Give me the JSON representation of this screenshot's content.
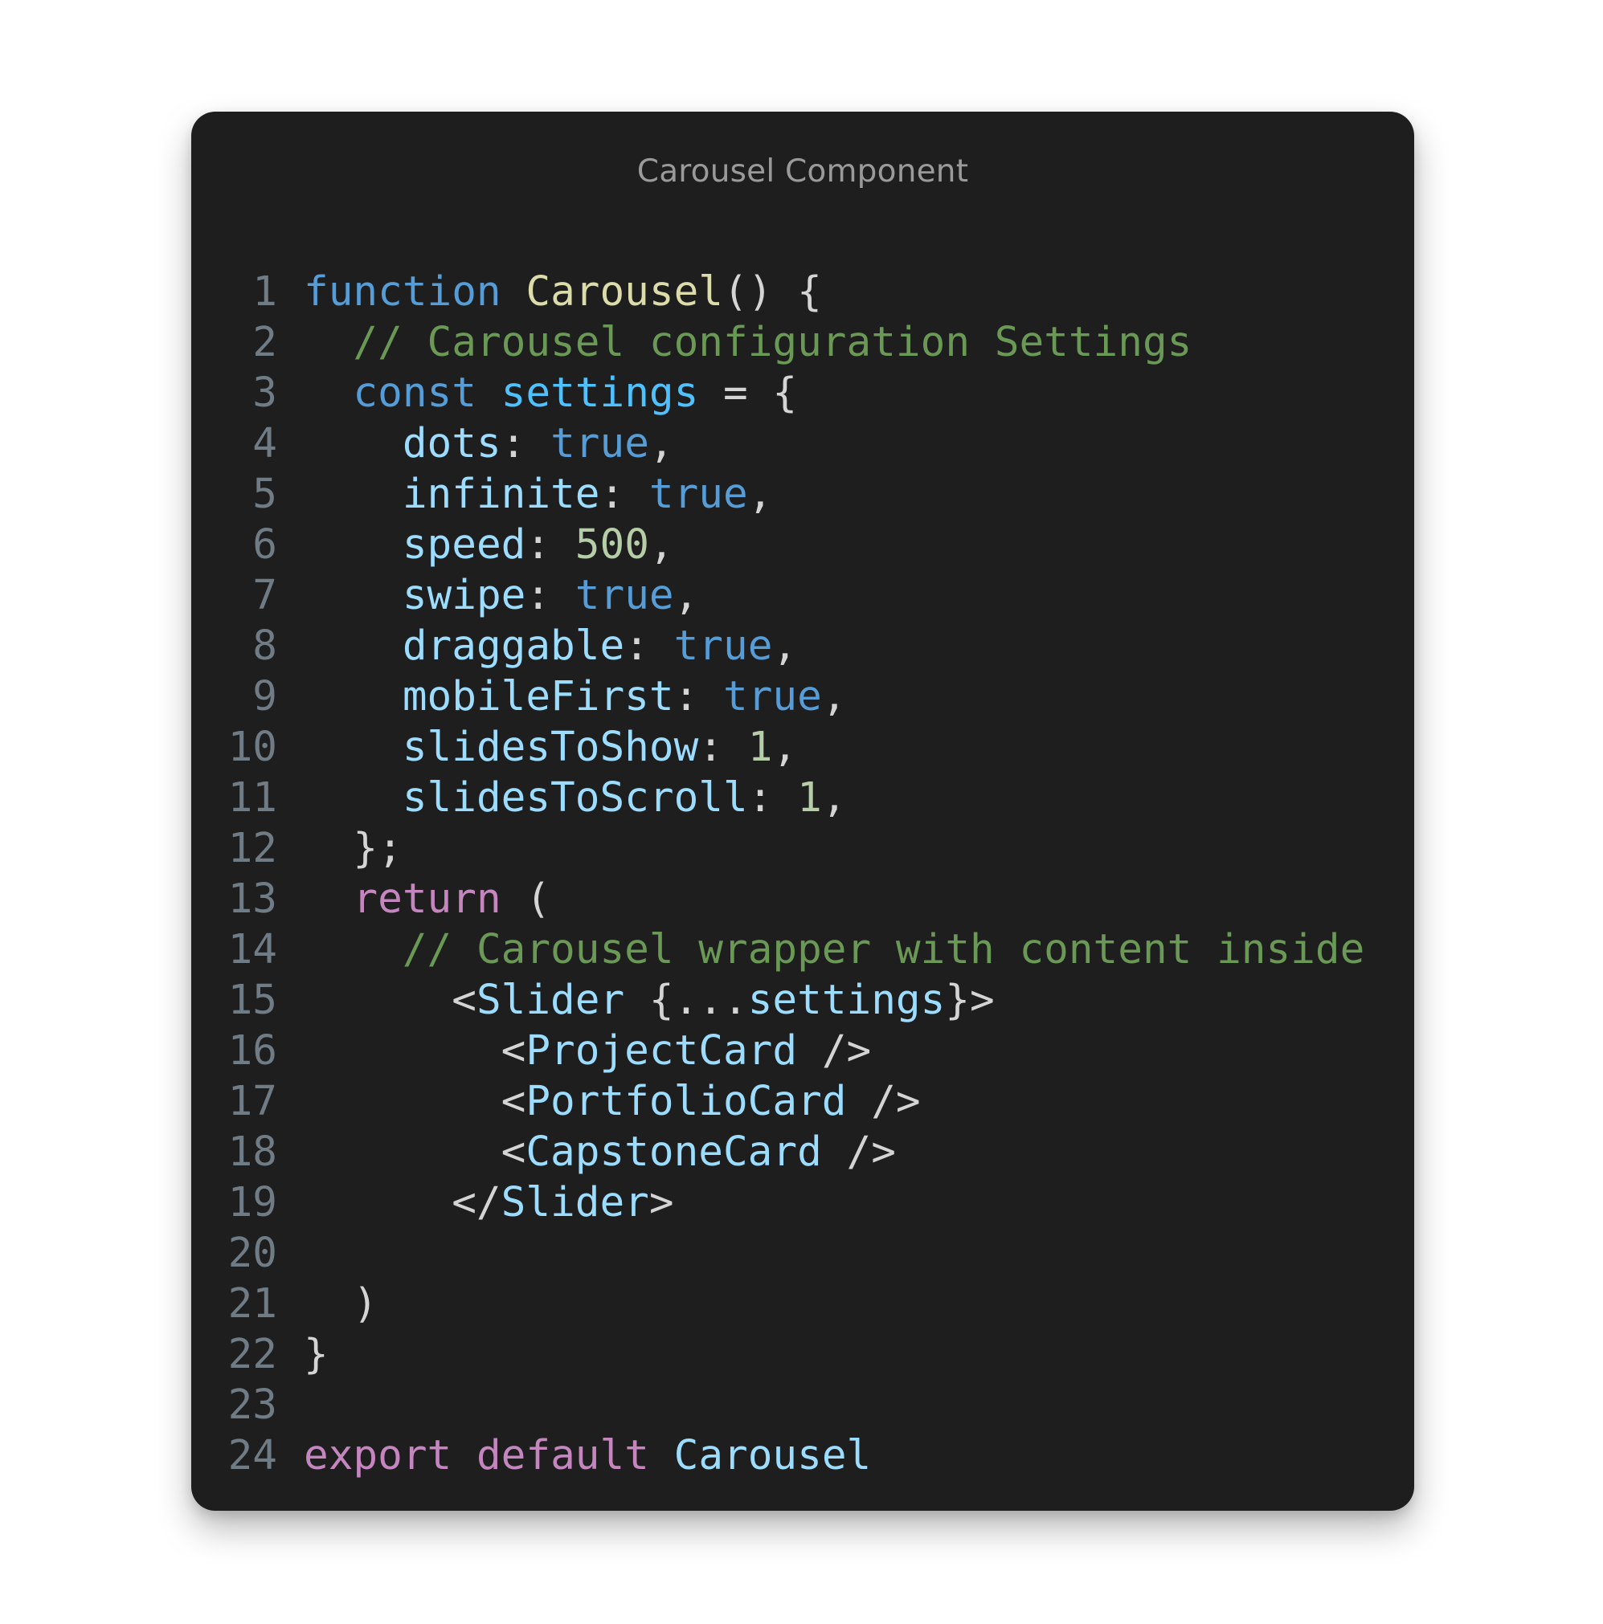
{
  "window": {
    "title": "Carousel Component"
  },
  "code": {
    "lines": [
      [
        {
          "t": "function",
          "k": "keyword"
        },
        {
          "t": " ",
          "k": "plain"
        },
        {
          "t": "Carousel",
          "k": "func"
        },
        {
          "t": "() {",
          "k": "punct"
        }
      ],
      [
        {
          "t": "  ",
          "k": "plain"
        },
        {
          "t": "// Carousel configuration Settings",
          "k": "comment"
        }
      ],
      [
        {
          "t": "  ",
          "k": "plain"
        },
        {
          "t": "const",
          "k": "keyword"
        },
        {
          "t": " ",
          "k": "plain"
        },
        {
          "t": "settings",
          "k": "var"
        },
        {
          "t": " = {",
          "k": "punct"
        }
      ],
      [
        {
          "t": "    ",
          "k": "plain"
        },
        {
          "t": "dots",
          "k": "prop"
        },
        {
          "t": ": ",
          "k": "punct"
        },
        {
          "t": "true",
          "k": "keyword"
        },
        {
          "t": ",",
          "k": "punct"
        }
      ],
      [
        {
          "t": "    ",
          "k": "plain"
        },
        {
          "t": "infinite",
          "k": "prop"
        },
        {
          "t": ": ",
          "k": "punct"
        },
        {
          "t": "true",
          "k": "keyword"
        },
        {
          "t": ",",
          "k": "punct"
        }
      ],
      [
        {
          "t": "    ",
          "k": "plain"
        },
        {
          "t": "speed",
          "k": "prop"
        },
        {
          "t": ": ",
          "k": "punct"
        },
        {
          "t": "500",
          "k": "number"
        },
        {
          "t": ",",
          "k": "punct"
        }
      ],
      [
        {
          "t": "    ",
          "k": "plain"
        },
        {
          "t": "swipe",
          "k": "prop"
        },
        {
          "t": ": ",
          "k": "punct"
        },
        {
          "t": "true",
          "k": "keyword"
        },
        {
          "t": ",",
          "k": "punct"
        }
      ],
      [
        {
          "t": "    ",
          "k": "plain"
        },
        {
          "t": "draggable",
          "k": "prop"
        },
        {
          "t": ": ",
          "k": "punct"
        },
        {
          "t": "true",
          "k": "keyword"
        },
        {
          "t": ",",
          "k": "punct"
        }
      ],
      [
        {
          "t": "    ",
          "k": "plain"
        },
        {
          "t": "mobileFirst",
          "k": "prop"
        },
        {
          "t": ": ",
          "k": "punct"
        },
        {
          "t": "true",
          "k": "keyword"
        },
        {
          "t": ",",
          "k": "punct"
        }
      ],
      [
        {
          "t": "    ",
          "k": "plain"
        },
        {
          "t": "slidesToShow",
          "k": "prop"
        },
        {
          "t": ": ",
          "k": "punct"
        },
        {
          "t": "1",
          "k": "number"
        },
        {
          "t": ",",
          "k": "punct"
        }
      ],
      [
        {
          "t": "    ",
          "k": "plain"
        },
        {
          "t": "slidesToScroll",
          "k": "prop"
        },
        {
          "t": ": ",
          "k": "punct"
        },
        {
          "t": "1",
          "k": "number"
        },
        {
          "t": ",",
          "k": "punct"
        }
      ],
      [
        {
          "t": "  };",
          "k": "punct"
        }
      ],
      [
        {
          "t": "  ",
          "k": "plain"
        },
        {
          "t": "return",
          "k": "control"
        },
        {
          "t": " (",
          "k": "punct"
        }
      ],
      [
        {
          "t": "    ",
          "k": "plain"
        },
        {
          "t": "// Carousel wrapper with content inside",
          "k": "comment"
        }
      ],
      [
        {
          "t": "      <",
          "k": "punct"
        },
        {
          "t": "Slider",
          "k": "tag"
        },
        {
          "t": " {...",
          "k": "punct"
        },
        {
          "t": "settings",
          "k": "prop"
        },
        {
          "t": "}>",
          "k": "punct"
        }
      ],
      [
        {
          "t": "        <",
          "k": "punct"
        },
        {
          "t": "ProjectCard",
          "k": "tag"
        },
        {
          "t": " />",
          "k": "punct"
        }
      ],
      [
        {
          "t": "        <",
          "k": "punct"
        },
        {
          "t": "PortfolioCard",
          "k": "tag"
        },
        {
          "t": " />",
          "k": "punct"
        }
      ],
      [
        {
          "t": "        <",
          "k": "punct"
        },
        {
          "t": "CapstoneCard",
          "k": "tag"
        },
        {
          "t": " />",
          "k": "punct"
        }
      ],
      [
        {
          "t": "      </",
          "k": "punct"
        },
        {
          "t": "Slider",
          "k": "tag"
        },
        {
          "t": ">",
          "k": "punct"
        }
      ],
      [],
      [
        {
          "t": "  )",
          "k": "punct"
        }
      ],
      [
        {
          "t": "}",
          "k": "punct"
        }
      ],
      [],
      [
        {
          "t": "export",
          "k": "control"
        },
        {
          "t": " ",
          "k": "plain"
        },
        {
          "t": "default",
          "k": "control"
        },
        {
          "t": " ",
          "k": "plain"
        },
        {
          "t": "Carousel",
          "k": "prop"
        }
      ]
    ],
    "line_numbers": [
      "1",
      "2",
      "3",
      "4",
      "5",
      "6",
      "7",
      "8",
      "9",
      "10",
      "11",
      "12",
      "13",
      "14",
      "15",
      "16",
      "17",
      "18",
      "19",
      "20",
      "21",
      "22",
      "23",
      "24"
    ]
  },
  "colors": {
    "background": "#1e1e1e",
    "keyword": "#569cd6",
    "control": "#c586c0",
    "function": "#dcdcaa",
    "variable": "#4fc1ff",
    "property": "#9cdcfe",
    "number": "#b5cea8",
    "comment": "#6a9955",
    "plain": "#d4d4d4",
    "line_number": "#6f7b85",
    "title": "#9a9a9a"
  }
}
